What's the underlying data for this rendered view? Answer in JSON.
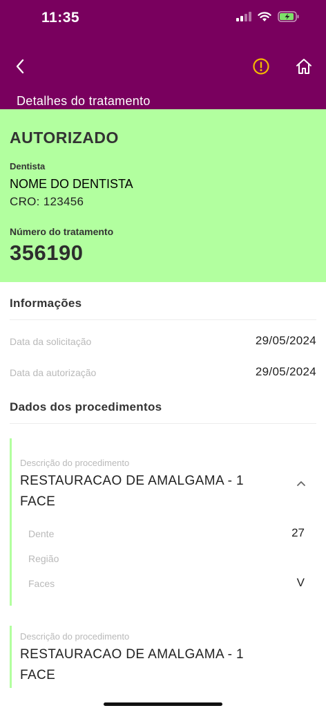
{
  "status_bar": {
    "time": "11:35"
  },
  "header": {
    "title": "Detalhes do tratamento"
  },
  "status": {
    "label": "AUTORIZADO",
    "dentista_label": "Dentista",
    "dentista_name": "NOME DO DENTISTA",
    "dentista_cro": "CRO: 123456",
    "numero_label": "Número do tratamento",
    "numero_value": "356190"
  },
  "informacoes": {
    "title": "Informações",
    "rows": [
      {
        "label": "Data da solicitação",
        "value": "29/05/2024"
      },
      {
        "label": "Data da autorização",
        "value": "29/05/2024"
      }
    ]
  },
  "procedimentos": {
    "title": "Dados dos procedimentos",
    "items": [
      {
        "desc_label": "Descrição do procedimento",
        "name": "RESTAURACAO DE AMALGAMA - 1 FACE",
        "rows": [
          {
            "label": "Dente",
            "value": "27"
          },
          {
            "label": "Região",
            "value": ""
          },
          {
            "label": "Faces",
            "value": "V"
          }
        ]
      },
      {
        "desc_label": "Descrição do procedimento",
        "name": "RESTAURACAO DE AMALGAMA - 1 FACE"
      }
    ]
  },
  "icons": [
    "back-chevron-icon",
    "alert-circle-icon",
    "home-icon",
    "chevron-up-icon"
  ],
  "colors": {
    "header_bg": "#79005e",
    "status_bg": "#b2ff9f",
    "alert_icon": "#f5b800",
    "battery": "#7ee06a"
  }
}
